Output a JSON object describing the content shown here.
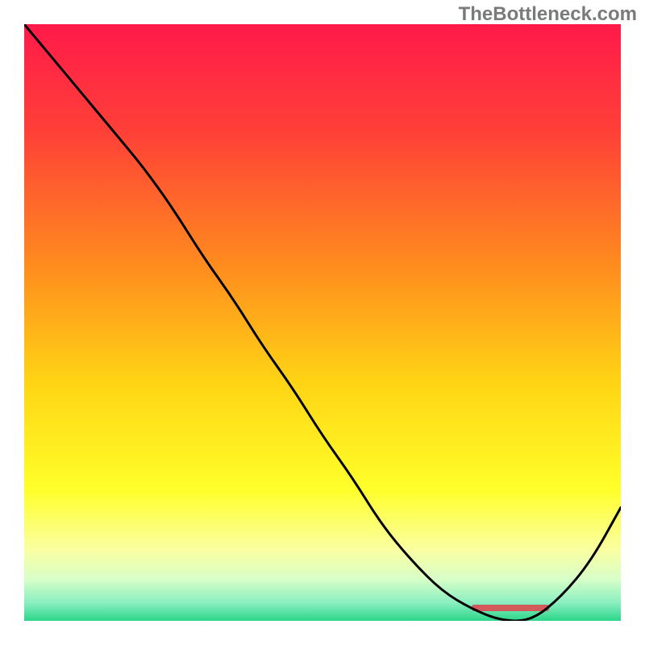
{
  "watermark": "TheBottleneck.com",
  "chart_data": {
    "type": "line",
    "title": "",
    "xlabel": "",
    "ylabel": "",
    "xlim": [
      0,
      100
    ],
    "ylim": [
      0,
      100
    ],
    "series": [
      {
        "name": "curve",
        "x": [
          0,
          5,
          10,
          15,
          20,
          25,
          30,
          35,
          40,
          45,
          50,
          55,
          60,
          65,
          70,
          75,
          80,
          85,
          90,
          95,
          100
        ],
        "values": [
          100,
          94,
          88,
          82,
          76,
          69,
          61,
          54,
          46,
          39,
          31,
          24,
          16,
          10,
          5,
          2,
          0,
          0,
          4,
          10,
          19
        ]
      }
    ],
    "minimum_region": {
      "x_start": 75,
      "x_end": 88
    },
    "gradient_stops": [
      {
        "offset": 0.0,
        "color": "#ff1a4a"
      },
      {
        "offset": 0.18,
        "color": "#ff4038"
      },
      {
        "offset": 0.4,
        "color": "#ff8a1f"
      },
      {
        "offset": 0.6,
        "color": "#ffd414"
      },
      {
        "offset": 0.78,
        "color": "#ffff2a"
      },
      {
        "offset": 0.88,
        "color": "#faffa0"
      },
      {
        "offset": 0.93,
        "color": "#d8ffc8"
      },
      {
        "offset": 0.97,
        "color": "#8aeec0"
      },
      {
        "offset": 1.0,
        "color": "#2bd689"
      }
    ]
  }
}
